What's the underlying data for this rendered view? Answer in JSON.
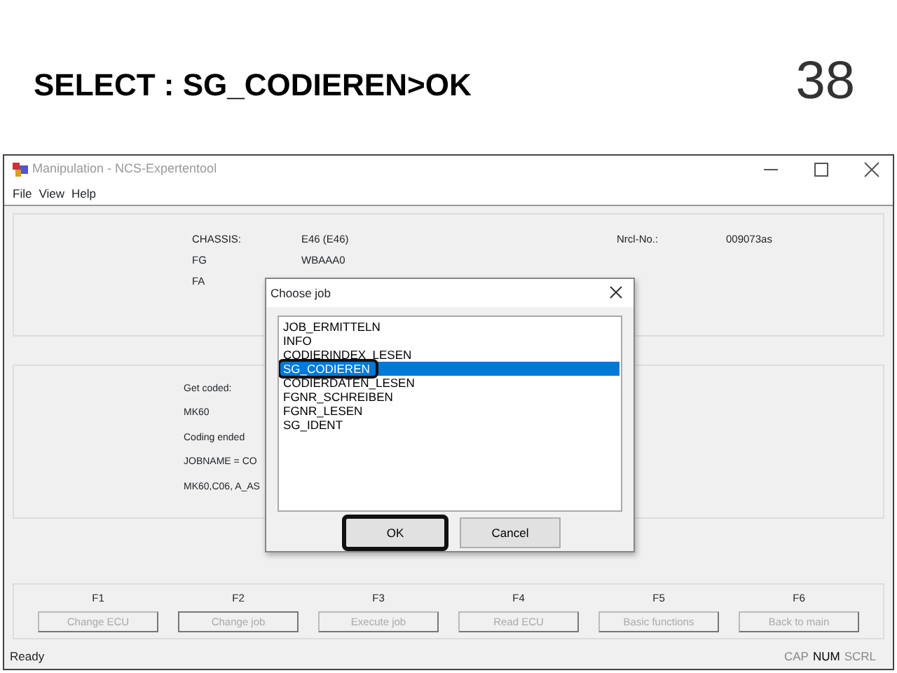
{
  "slide": {
    "heading": "SELECT : SG_CODIEREN>OK",
    "page_number": "38"
  },
  "window": {
    "title": "Manipulation - NCS-Expertentool",
    "active": false
  },
  "menu": [
    "File",
    "View",
    "Help"
  ],
  "vehicle_info": [
    {
      "label": "CHASSIS:",
      "value": "E46 (E46)"
    },
    {
      "label": "FG",
      "value": "WBAAA0"
    },
    {
      "label": "FA"
    }
  ],
  "part_number": {
    "label": "Nrcl-No.:",
    "value": "009073as"
  },
  "log_lines": [
    "Get coded:",
    "MK60",
    "Coding ended",
    "JOBNAME = CO",
    "MK60,C06, A_AS"
  ],
  "dialog": {
    "title": "Choose job",
    "jobs": [
      {
        "label": "JOB_ERMITTELN",
        "selected": false,
        "callout": false
      },
      {
        "label": "INFO",
        "selected": false,
        "callout": false
      },
      {
        "label": "CODIERINDEX_LESEN",
        "selected": false,
        "callout": false
      },
      {
        "label": "SG_CODIEREN",
        "selected": true,
        "callout": true
      },
      {
        "label": "CODIERDATEN_LESEN",
        "selected": false,
        "callout": false
      },
      {
        "label": "FGNR_SCHREIBEN",
        "selected": false,
        "callout": false
      },
      {
        "label": "FGNR_LESEN",
        "selected": false,
        "callout": false
      },
      {
        "label": "SG_IDENT",
        "selected": false,
        "callout": false
      }
    ],
    "buttons": [
      {
        "label": "OK",
        "callout": true
      },
      {
        "label": "Cancel",
        "callout": false
      }
    ]
  },
  "function_keys": [
    {
      "key": "F1",
      "label": "Change ECU",
      "disabled": true,
      "focused": false
    },
    {
      "key": "F2",
      "label": "Change job",
      "disabled": true,
      "focused": true
    },
    {
      "key": "F3",
      "label": "Execute job",
      "disabled": true,
      "focused": false
    },
    {
      "key": "F4",
      "label": "Read ECU",
      "disabled": true,
      "focused": false
    },
    {
      "key": "F5",
      "label": "Basic functions",
      "disabled": true,
      "focused": false
    },
    {
      "key": "F6",
      "label": "Back to main",
      "disabled": true,
      "focused": false
    }
  ],
  "status_bar": {
    "text": "Ready",
    "indicators": [
      {
        "label": "CAP",
        "on": false
      },
      {
        "label": "NUM",
        "on": true
      },
      {
        "label": "SCRL",
        "on": false
      }
    ]
  }
}
